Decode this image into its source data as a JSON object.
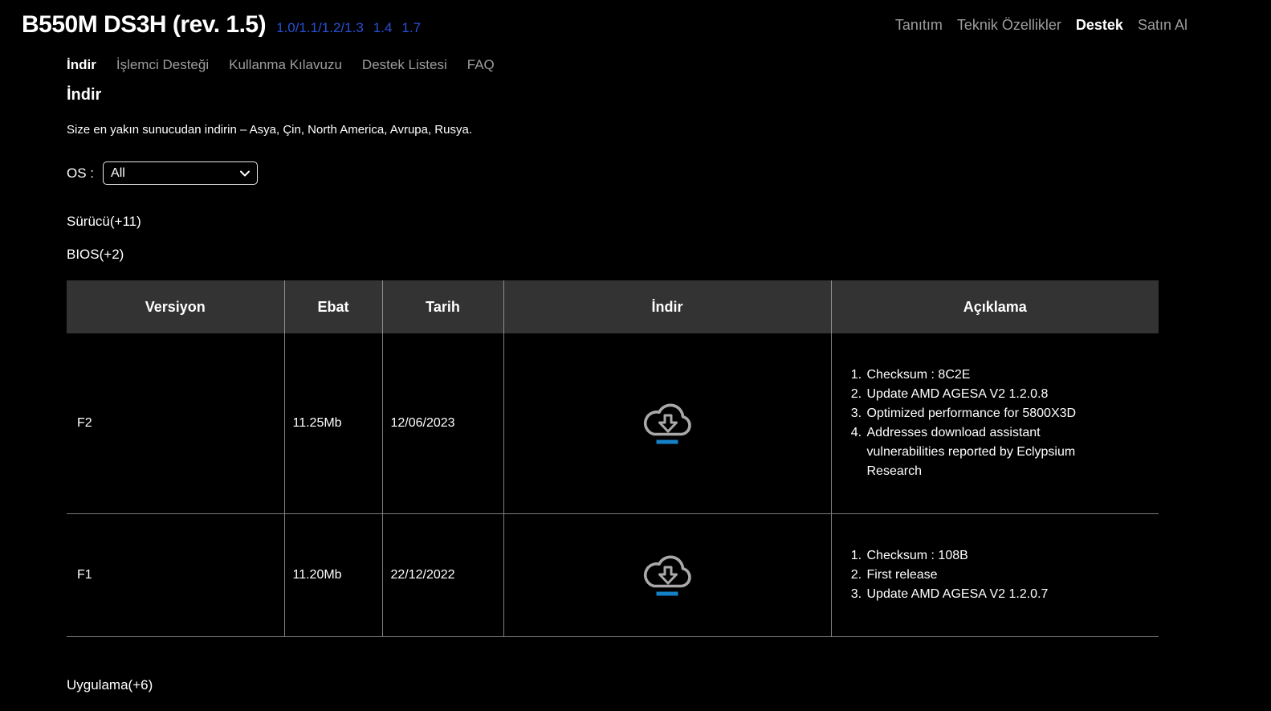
{
  "header": {
    "title": "B550M DS3H (rev. 1.5)",
    "revisions": [
      {
        "label": "1.0/1.1/1.2/1.3"
      },
      {
        "label": "1.4"
      },
      {
        "label": "1.7"
      }
    ],
    "top_nav": [
      {
        "label": "Tanıtım",
        "active": false
      },
      {
        "label": "Teknik Özellikler",
        "active": false
      },
      {
        "label": "Destek",
        "active": true
      },
      {
        "label": "Satın Al",
        "active": false
      }
    ]
  },
  "sub_nav": [
    {
      "label": "İndir",
      "active": true
    },
    {
      "label": "İşlemci Desteği",
      "active": false
    },
    {
      "label": "Kullanma Kılavuzu",
      "active": false
    },
    {
      "label": "Destek Listesi",
      "active": false
    },
    {
      "label": "FAQ",
      "active": false
    }
  ],
  "download_section": {
    "heading": "İndir",
    "description": "Size en yakın sunucudan indirin – Asya, Çin, North America, Avrupa, Rusya.",
    "os_filter": {
      "label": "OS :",
      "selected": "All"
    },
    "accordions": {
      "driver": "Sürücü(+11)",
      "bios": "BIOS(+2)",
      "application": "Uygulama(+6)"
    },
    "table": {
      "headers": {
        "version": "Versiyon",
        "size": "Ebat",
        "date": "Tarih",
        "download": "İndir",
        "notes": "Açıklama"
      },
      "rows": [
        {
          "version": "F2",
          "size": "11.25Mb",
          "date": "12/06/2023",
          "icon": "cloud-download-icon",
          "notes": [
            "Checksum : 8C2E",
            "Update AMD AGESA V2 1.2.0.8",
            "Optimized performance for 5800X3D",
            "Addresses download assistant vulnerabilities reported by Eclypsium Research"
          ]
        },
        {
          "version": "F1",
          "size": "11.20Mb",
          "date": "22/12/2022",
          "icon": "cloud-download-icon",
          "notes": [
            "Checksum : 108B",
            "First release",
            "Update AMD AGESA V2 1.2.0.7"
          ]
        }
      ]
    }
  },
  "colors": {
    "background": "#000000",
    "link_blue": "#2850d7",
    "nav_gray": "#9d9d9d",
    "table_header_bg": "#333333",
    "table_border": "#7d7d7d",
    "icon_gray": "#a9a9a9",
    "icon_accent_blue": "#1582c8"
  }
}
